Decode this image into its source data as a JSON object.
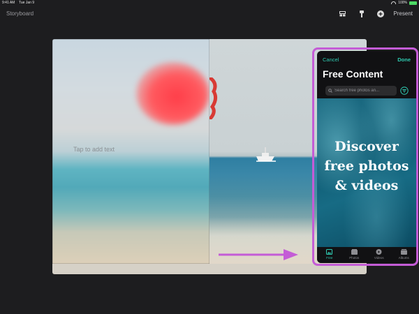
{
  "status_bar": {
    "time": "9:41 AM",
    "date": "Tue Jan 9",
    "battery": "100%"
  },
  "toolbar": {
    "title": "Storyboard",
    "present_label": "Present"
  },
  "slide": {
    "placeholder_text": "Tap to add text"
  },
  "panel": {
    "cancel_label": "Cancel",
    "done_label": "Done",
    "title": "Free Content",
    "search_placeholder": "Search free photos an...",
    "hero_text": [
      "Discover",
      "free photos",
      "& videos"
    ],
    "tabs": [
      {
        "label": "Free",
        "icon": "free-photos-icon",
        "active": true
      },
      {
        "label": "Photos",
        "icon": "photos-icon",
        "active": false
      },
      {
        "label": "Videos",
        "icon": "videos-icon",
        "active": false
      },
      {
        "label": "Albums",
        "icon": "albums-icon",
        "active": false
      }
    ]
  },
  "colors": {
    "accent": "#2fc9b0",
    "highlight": "#c45cd6",
    "background": "#1d1d1f"
  }
}
